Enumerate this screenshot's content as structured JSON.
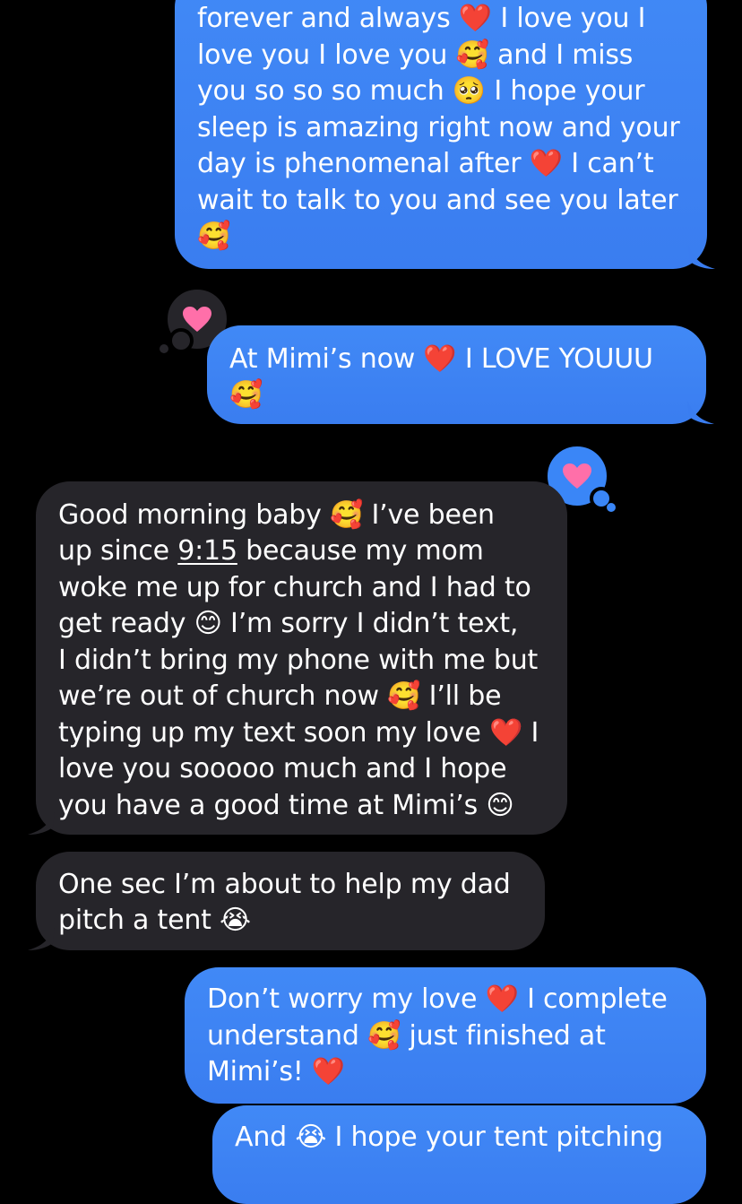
{
  "messages": [
    {
      "id": "m1",
      "direction": "sent",
      "lines": [
        "forever and always ❤️ I love you I",
        "love you I love you 🥰 and I miss",
        "you so so so much 🥺 I hope your",
        "sleep is amazing right now and your",
        "day is phenomenal after ❤️ I can’t",
        "wait to talk to you and see you later",
        "🥰"
      ]
    },
    {
      "id": "m2",
      "direction": "sent",
      "tapback": "heart",
      "lines": [
        "At Mimi’s now ❤️ I LOVE YOUUU",
        "🥰"
      ]
    },
    {
      "id": "m3",
      "direction": "received",
      "tapback": "heart",
      "lines": [
        "Good morning baby 🥰 I’ve been",
        "up since ",
        "woke me up for church and I had to",
        "get ready 😊 I’m sorry I didn’t text,",
        "I didn’t bring my phone with me but",
        "we’re out of church now 🥰 I’ll be",
        "typing up my text soon my love ❤️ I",
        "love you sooooo much and I hope",
        "you have a good time at Mimi’s 😊"
      ],
      "time_link": "9:15",
      "line2_rest": " because my mom"
    },
    {
      "id": "m4",
      "direction": "received",
      "lines": [
        "One sec I’m about to help my dad",
        "pitch a tent 😭"
      ]
    },
    {
      "id": "m5",
      "direction": "sent",
      "lines": [
        "Don’t worry my love ❤️ I complete",
        "understand 🥰 just finished at",
        "Mimi’s! ❤️"
      ]
    },
    {
      "id": "m6",
      "direction": "sent",
      "lines": [
        "And 😭 I hope your tent pitching"
      ]
    }
  ],
  "icons": {
    "tapback_heart": "heart-icon"
  },
  "colors": {
    "background": "#000000",
    "sent_bubble": "#3b82f6",
    "received_bubble": "#26252a",
    "heart": "#ff6fa9",
    "text": "#ffffff"
  }
}
